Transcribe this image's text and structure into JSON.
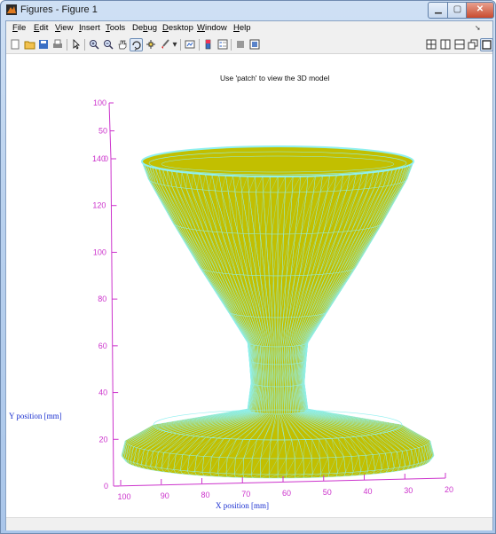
{
  "window": {
    "title": "Figures - Figure 1"
  },
  "menu": {
    "file": {
      "pre": "",
      "u": "F",
      "post": "ile"
    },
    "edit": {
      "pre": "",
      "u": "E",
      "post": "dit"
    },
    "view": {
      "pre": "",
      "u": "V",
      "post": "iew"
    },
    "insert": {
      "pre": "",
      "u": "I",
      "post": "nsert"
    },
    "tools": {
      "pre": "",
      "u": "T",
      "post": "ools"
    },
    "debug": {
      "pre": "De",
      "u": "b",
      "post": "ug"
    },
    "desktop": {
      "pre": "",
      "u": "D",
      "post": "esktop"
    },
    "window": {
      "pre": "",
      "u": "W",
      "post": "indow"
    },
    "help": {
      "pre": "",
      "u": "H",
      "post": "elp"
    }
  },
  "toolbar": {
    "icons": [
      "new-figure-icon",
      "open-file-icon",
      "save-icon",
      "print-icon",
      "pointer-icon",
      "zoom-in-icon",
      "zoom-out-icon",
      "pan-icon",
      "rotate-3d-icon",
      "data-cursor-icon",
      "brush-icon",
      "link-plot-icon",
      "colorbar-icon",
      "legend-icon",
      "hide-plot-tools-icon",
      "show-plot-tools-icon"
    ],
    "rotate_active": true
  },
  "dock": {
    "icons": [
      "tile-icon",
      "left-right-icon",
      "top-bottom-icon",
      "float-icon",
      "maximize-icon"
    ]
  },
  "plot": {
    "title": "Use 'patch' to view the 3D model",
    "ylabel": "Y position [mm]",
    "xlabel": "X position [mm]",
    "y_ticks": [
      "0",
      "20",
      "40",
      "60",
      "80",
      "100",
      "120",
      "140"
    ],
    "z_ticks": [
      "0",
      "50",
      "100"
    ],
    "x_ticks": [
      "100",
      "90",
      "80",
      "70",
      "60",
      "50",
      "40",
      "30",
      "20"
    ],
    "colors": {
      "axis": "#cc33cc",
      "face": "#c2bf00",
      "edge": "#8ff0f0",
      "label_blue": "#1a2fd0"
    }
  }
}
